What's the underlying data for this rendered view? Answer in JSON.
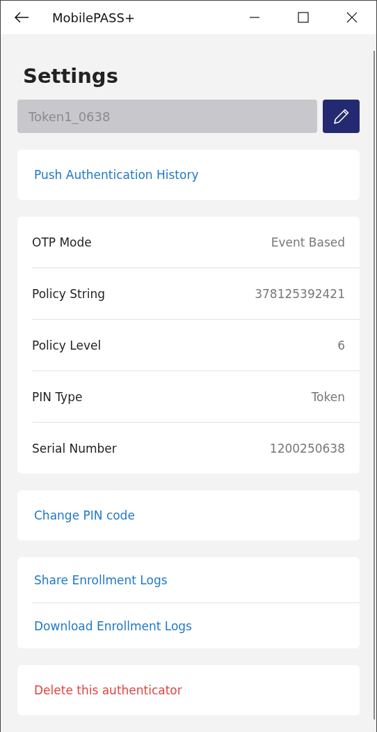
{
  "window": {
    "title": "MobilePASS+"
  },
  "page": {
    "title": "Settings"
  },
  "token_name": {
    "value": "Token1_0638",
    "disabled": true
  },
  "sections": [
    {
      "kind": "links",
      "items": [
        {
          "label": "Push Authentication History",
          "kind": "link"
        }
      ]
    },
    {
      "kind": "details",
      "items": [
        {
          "label": "OTP Mode",
          "value": "Event Based"
        },
        {
          "label": "Policy String",
          "value": "378125392421"
        },
        {
          "label": "Policy Level",
          "value": "6"
        },
        {
          "label": "PIN Type",
          "value": "Token"
        },
        {
          "label": "Serial Number",
          "value": "1200250638"
        }
      ]
    },
    {
      "kind": "links",
      "items": [
        {
          "label": "Change PIN code",
          "kind": "link"
        }
      ]
    },
    {
      "kind": "links",
      "items": [
        {
          "label": "Share Enrollment Logs",
          "kind": "link"
        },
        {
          "label": "Download Enrollment Logs",
          "kind": "link"
        }
      ]
    },
    {
      "kind": "links",
      "items": [
        {
          "label": "Delete this authenticator",
          "kind": "danger"
        }
      ]
    }
  ]
}
